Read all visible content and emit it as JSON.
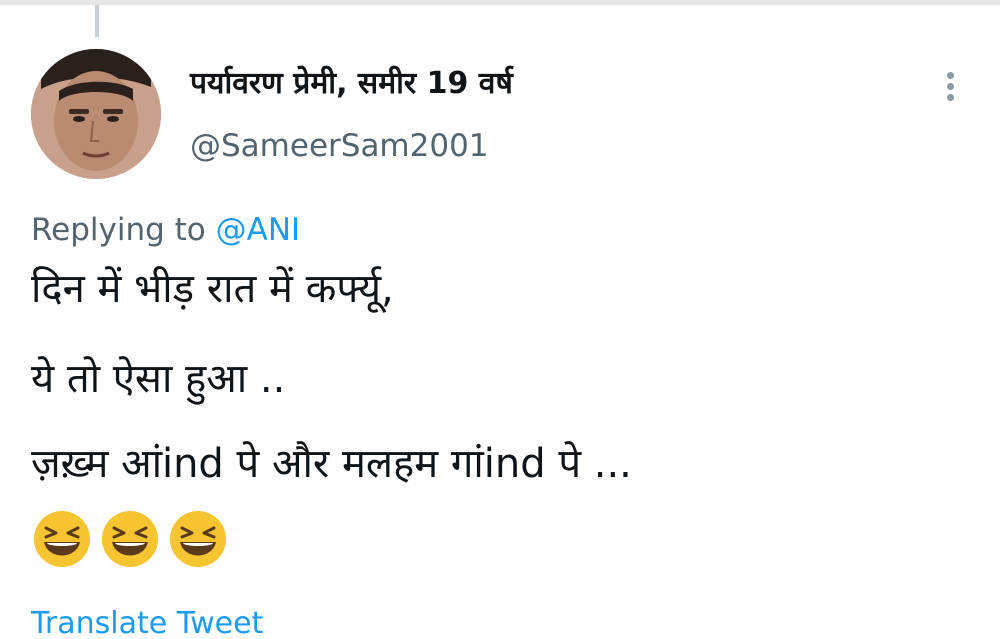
{
  "tweet": {
    "author": {
      "display_name": "पर्यावरण प्रेमी, समीर 19 वर्ष",
      "handle": "@SameerSam2001",
      "avatar": "profile-photo"
    },
    "replying_to": {
      "prefix": "Replying to",
      "mention": "@ANI"
    },
    "text_lines": [
      "दिन में भीड़ रात में कर्फ्यू,",
      "ये तो ऐसा हुआ ..",
      "ज़ख़्म आंind पे और मलहम गांind पे ..."
    ],
    "emojis": [
      "grinning-squinting-face",
      "grinning-squinting-face",
      "grinning-squinting-face"
    ],
    "translate_label": "Translate Tweet",
    "more_icon": "more-vertical-icon"
  },
  "colors": {
    "link_blue": "#1d9bf0",
    "secondary_text": "#536471",
    "primary_text": "#0f1419",
    "emoji_yellow": "#f6c431"
  }
}
